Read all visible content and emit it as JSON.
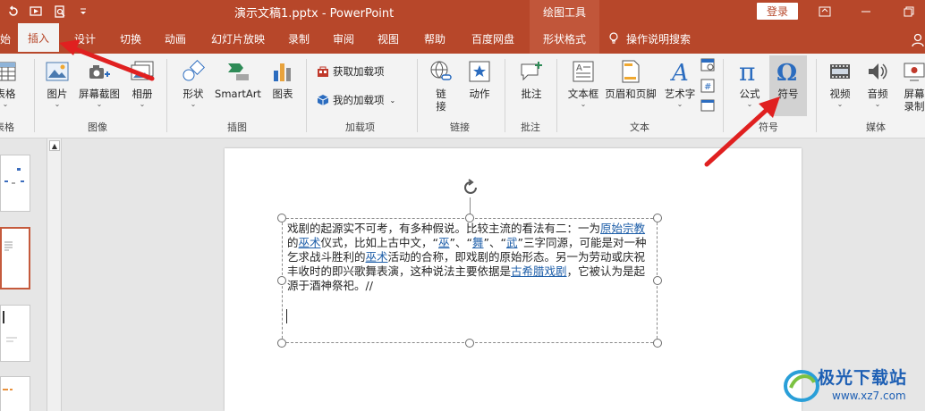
{
  "titlebar": {
    "doc_title": "演示文稿1.pptx  -  PowerPoint",
    "context_tools": "绘图工具",
    "login": "登录"
  },
  "tabs": [
    {
      "label": "始"
    },
    {
      "label": "插入"
    },
    {
      "label": "设计"
    },
    {
      "label": "切换"
    },
    {
      "label": "动画"
    },
    {
      "label": "幻灯片放映"
    },
    {
      "label": "录制"
    },
    {
      "label": "审阅"
    },
    {
      "label": "视图"
    },
    {
      "label": "帮助"
    },
    {
      "label": "百度网盘"
    },
    {
      "label": "形状格式"
    },
    {
      "label": "操作说明搜索"
    }
  ],
  "ribbon": {
    "table": {
      "label": "表格",
      "group": "表格"
    },
    "image_group": {
      "label": "图像",
      "pictures": "图片",
      "screenshot": "屏幕截图",
      "album": "相册"
    },
    "illustrations": {
      "label": "插图",
      "shapes": "形状",
      "smartart": "SmartArt",
      "chart": "图表"
    },
    "addins": {
      "label": "加载项",
      "get": "获取加载项",
      "mine": "我的加载项"
    },
    "links": {
      "label": "链接",
      "link": "链\n接",
      "action": "动作"
    },
    "comments": {
      "label": "批注",
      "comment": "批注"
    },
    "text": {
      "label": "文本",
      "textbox": "文本框",
      "header_footer": "页眉和页脚",
      "wordart": "艺术字"
    },
    "symbols": {
      "label": "符号",
      "equation": "公式",
      "symbol": "符号"
    },
    "media": {
      "label": "媒体",
      "video": "视频",
      "audio": "音频",
      "screen_rec": "屏幕\n录制"
    }
  },
  "slide_text": {
    "p1": "戏剧的起源实不可考，有多种假说。比较主流的看法有二：一为",
    "l1": "原始宗教",
    "p2": "的",
    "l2": "巫术",
    "p3": "仪式，比如上古中文，“",
    "l3": "巫",
    "p4": "”、“",
    "l4": "舞",
    "p5": "”、“",
    "l5": "武",
    "p6": "”三字同源，可能是对一种乞求战斗胜利的",
    "l6": "巫术",
    "p7": "活动的合称，即戏剧的原始形态。另一为劳动或庆祝丰收时的即兴歌舞表演，这种说法主要依据是",
    "l7": "古希腊戏剧",
    "p8": "，它被认为是起源于酒神祭祀。//"
  },
  "watermark": {
    "name": "极光下载站",
    "url": "www.xz7.com"
  },
  "colors": {
    "brand": "#b7472a",
    "link": "#1f5fa9",
    "arrow": "#e02020"
  }
}
